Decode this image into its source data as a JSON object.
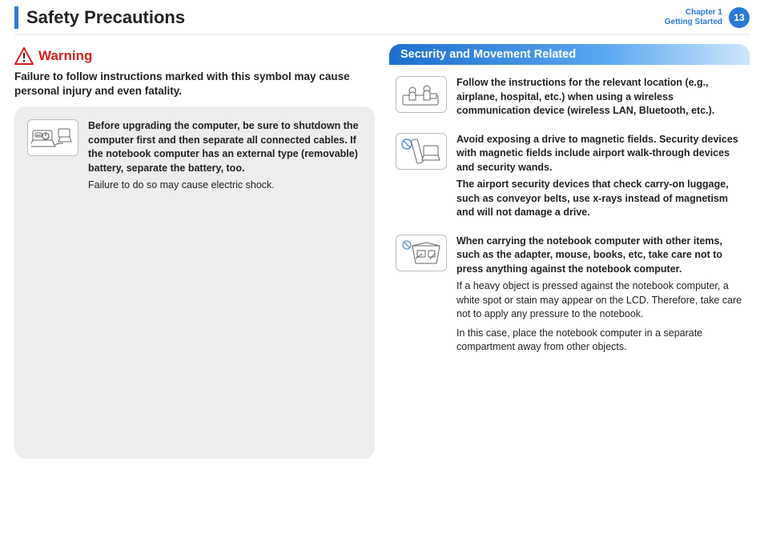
{
  "header": {
    "title": "Safety Precautions",
    "chapter_line1": "Chapter 1",
    "chapter_line2": "Getting Started",
    "page": "13"
  },
  "warning": {
    "label": "Warning",
    "sub": "Failure to follow instructions marked with this symbol may cause personal injury and even fatality."
  },
  "left_card": {
    "item1_bold": "Before upgrading the computer, be sure to shutdown the computer first and then separate all connected cables. If the notebook computer has an external type (removable) battery, separate the battery, too.",
    "item1_plain": "Failure to do so may cause electric shock."
  },
  "right": {
    "banner": "Security and Movement Related",
    "item1_bold": "Follow the instructions for the relevant location (e.g., airplane, hospital, etc.) when using a wireless communication device (wireless LAN, Bluetooth, etc.).",
    "item2_bold": "Avoid exposing a drive to magnetic fields. Security devices with magnetic fields include airport walk-through devices and security wands.",
    "item2_bold2": "The airport security devices that check carry-on luggage, such as conveyor belts, use x-rays instead of magnetism and will not damage a drive.",
    "item3_bold": "When carrying the notebook computer with other items, such as the adapter, mouse, books, etc, take care not to press anything against the notebook computer.",
    "item3_p1": "If a heavy object is pressed against the notebook computer, a white spot or stain may appear on the LCD. Therefore, take care not to apply any pressure to the notebook.",
    "item3_p2": "In this case, place the notebook computer in a separate compartment away from other objects."
  }
}
